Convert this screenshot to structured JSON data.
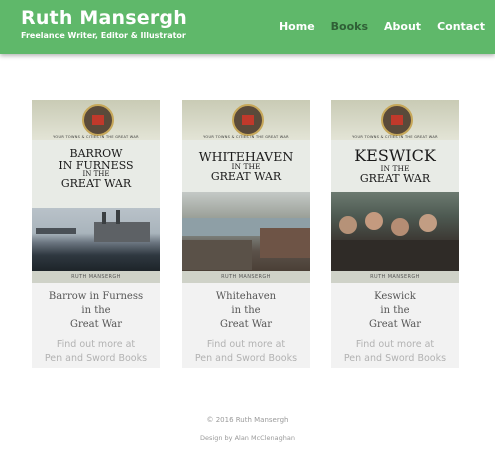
{
  "header": {
    "site_title": "Ruth Mansergh",
    "subtitle": "Freelance Writer, Editor & Illustrator",
    "nav": [
      "Home",
      "Books",
      "About",
      "Contact"
    ],
    "active_nav": "Books",
    "color": "#5fb86a"
  },
  "books": [
    {
      "cover_series": "YOUR TOWNS & CITIES IN THE GREAT WAR",
      "cover_title_lines": [
        "BARROW",
        "IN FURNESS",
        "IN THE",
        "GREAT WAR"
      ],
      "cover_author": "RUTH MANSERGH",
      "title_lines": [
        "Barrow in Furness",
        "in the",
        "Great War"
      ],
      "link_lines": [
        "Find out more at",
        "Pen and Sword Books"
      ]
    },
    {
      "cover_series": "YOUR TOWNS & CITIES IN THE GREAT WAR",
      "cover_title_lines": [
        "WHITEHAVEN",
        "IN THE",
        "GREAT WAR"
      ],
      "cover_author": "RUTH MANSERGH",
      "title_lines": [
        "Whitehaven",
        "in the",
        "Great War"
      ],
      "link_lines": [
        "Find out more at",
        "Pen and Sword Books"
      ]
    },
    {
      "cover_series": "YOUR TOWNS & CITIES IN THE GREAT WAR",
      "cover_title_lines": [
        "KESWICK",
        "IN THE",
        "GREAT WAR"
      ],
      "cover_author": "RUTH MANSERGH",
      "title_lines": [
        "Keswick",
        "in the",
        "Great War"
      ],
      "link_lines": [
        "Find out more at",
        "Pen and Sword Books"
      ]
    }
  ],
  "footer": {
    "copyright": "© 2016 Ruth Mansergh",
    "design": "Design by Alan McClenaghan"
  }
}
